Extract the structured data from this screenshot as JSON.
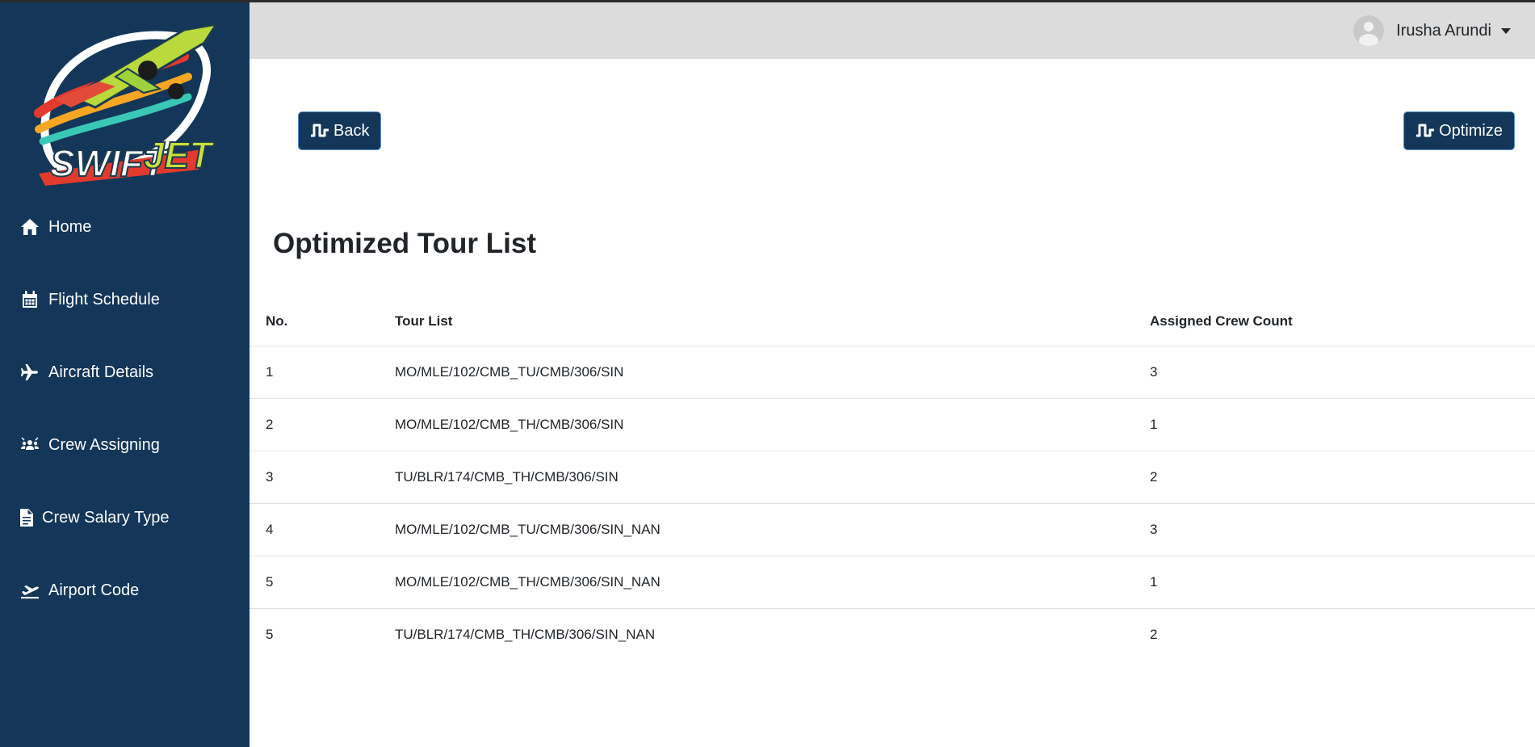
{
  "brand": {
    "logo_text": "SWIFTJET",
    "logo_text_1": "SWIFT",
    "logo_text_2": "JET"
  },
  "sidebar": {
    "items": [
      {
        "label": "Home",
        "icon": "home-icon"
      },
      {
        "label": "Flight Schedule",
        "icon": "calendar-icon"
      },
      {
        "label": "Aircraft Details",
        "icon": "plane-icon"
      },
      {
        "label": "Crew Assigning",
        "icon": "crew-icon"
      },
      {
        "label": "Crew Salary Type",
        "icon": "document-icon"
      },
      {
        "label": "Airport Code",
        "icon": "plane-departure-icon"
      }
    ]
  },
  "header": {
    "user_name": "Irusha Arundi"
  },
  "toolbar": {
    "back_label": "Back",
    "optimize_label": "Optimize"
  },
  "main": {
    "title": "Optimized Tour List",
    "columns": [
      "No.",
      "Tour List",
      "Assigned Crew Count"
    ],
    "rows": [
      {
        "no": "1",
        "tour": "MO/MLE/102/CMB_TU/CMB/306/SIN",
        "count": "3"
      },
      {
        "no": "2",
        "tour": "MO/MLE/102/CMB_TH/CMB/306/SIN",
        "count": "1"
      },
      {
        "no": "3",
        "tour": "TU/BLR/174/CMB_TH/CMB/306/SIN",
        "count": "2"
      },
      {
        "no": "4",
        "tour": "MO/MLE/102/CMB_TU/CMB/306/SIN_NAN",
        "count": "3"
      },
      {
        "no": "5",
        "tour": "MO/MLE/102/CMB_TH/CMB/306/SIN_NAN",
        "count": "1"
      },
      {
        "no": "5",
        "tour": "TU/BLR/174/CMB_TH/CMB/306/SIN_NAN",
        "count": "2"
      }
    ]
  },
  "colors": {
    "sidebar": "#133659",
    "header": "#dcdcdc",
    "button": "#133659",
    "button_border": "#5a93d1"
  }
}
